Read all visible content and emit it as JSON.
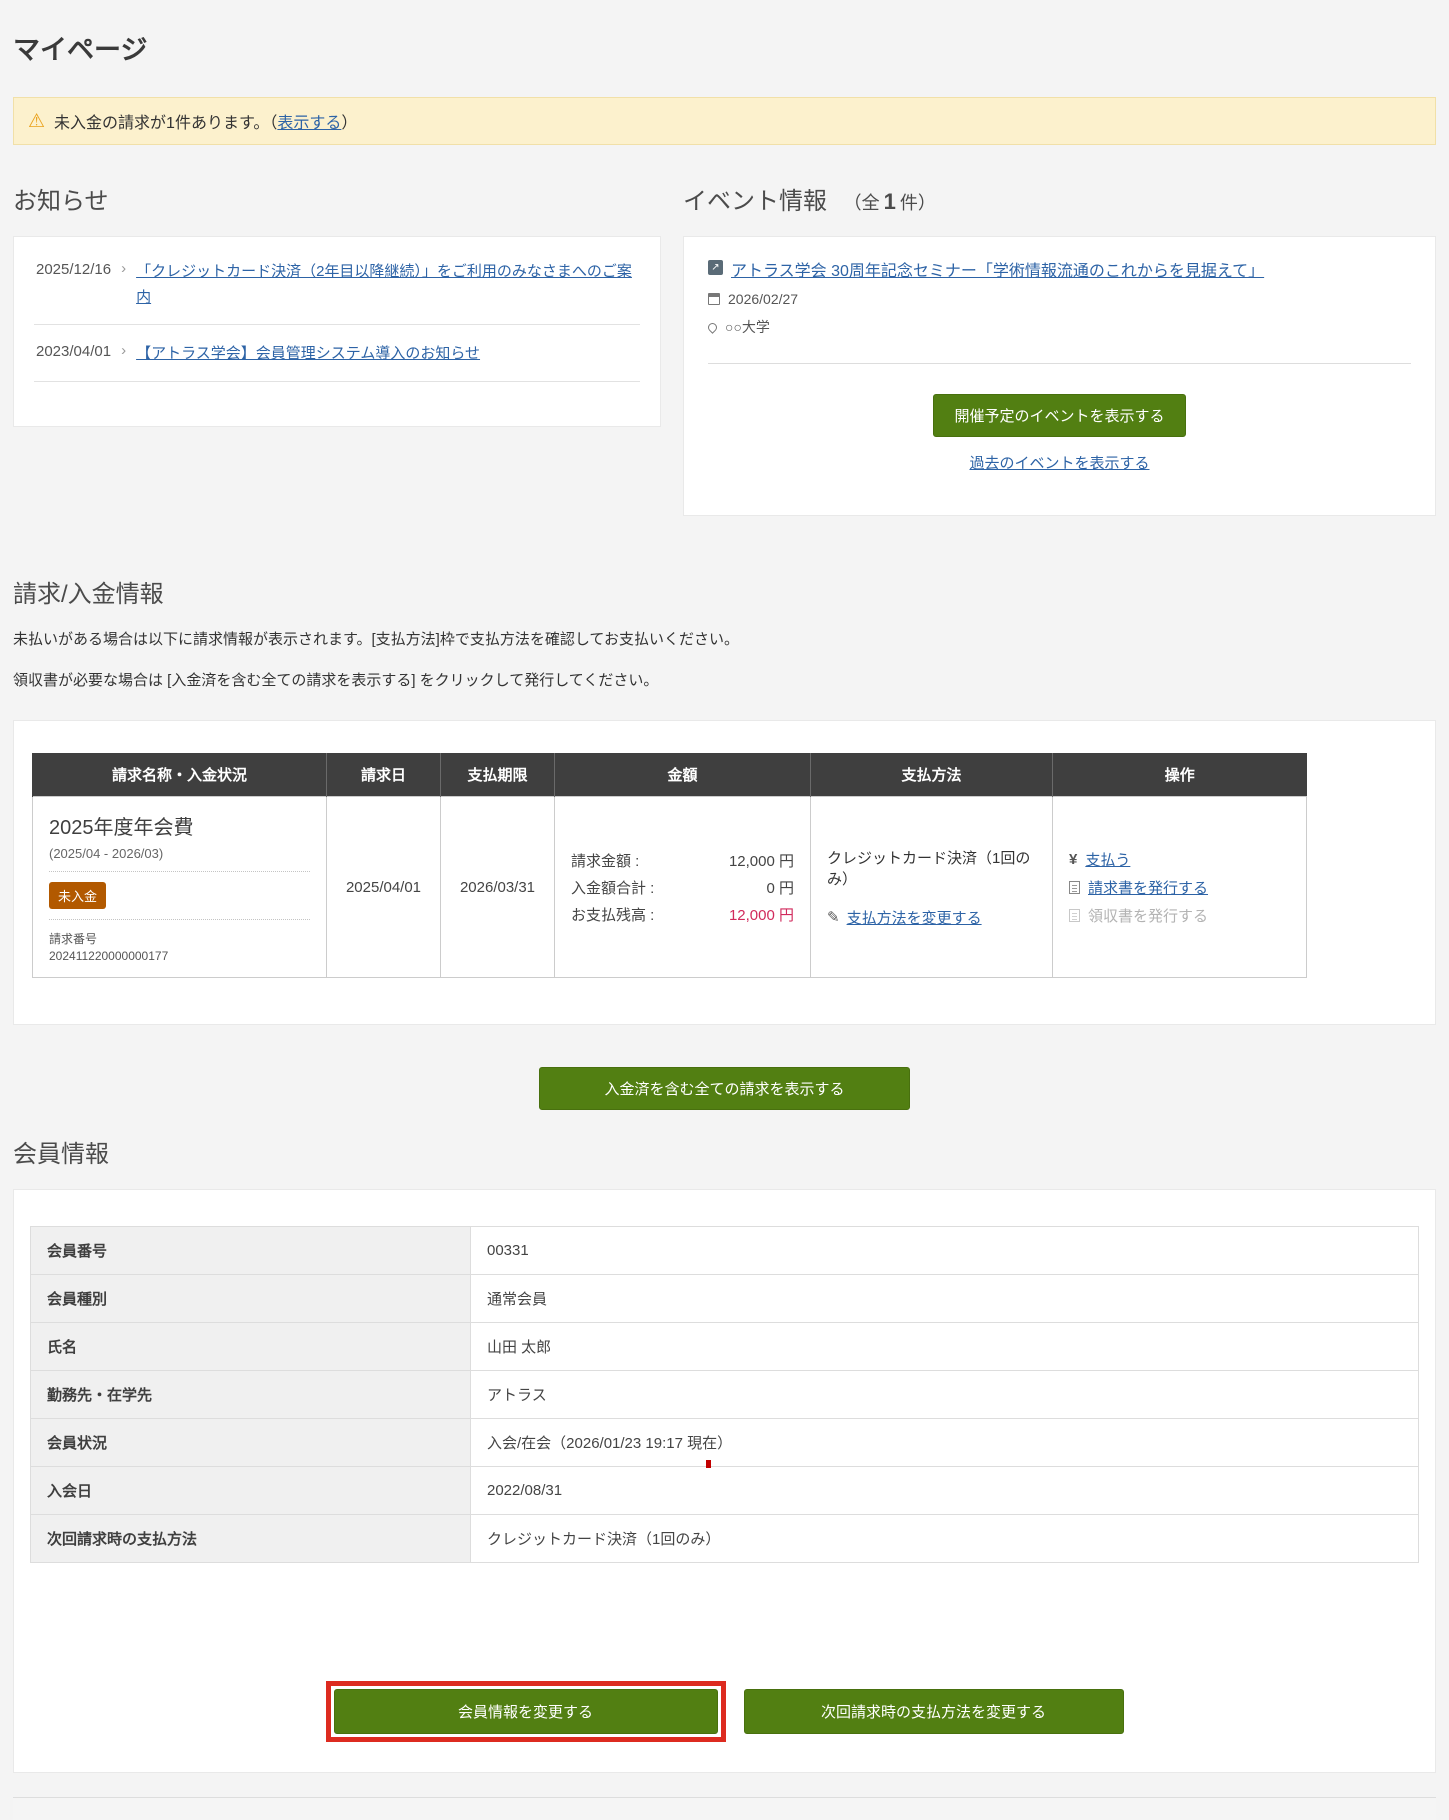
{
  "page": {
    "title": "マイページ"
  },
  "warning": {
    "text_before": "未入金の請求が1件あります。（",
    "link_label": "表示する",
    "text_after": "）"
  },
  "notices": {
    "heading": "お知らせ",
    "items": [
      {
        "date": "2025/12/16",
        "title": "「クレジットカード決済（2年目以降継続）」をご利用のみなさまへのご案内"
      },
      {
        "date": "2023/04/01",
        "title": "【アトラス学会】会員管理システム導入のお知らせ"
      }
    ]
  },
  "events": {
    "heading": "イベント情報",
    "count_prefix": "（全",
    "count": "1",
    "count_suffix": "件）",
    "item": {
      "title": "アトラス学会 30周年記念セミナー「学術情報流通のこれからを見据えて」",
      "date": "2026/02/27",
      "place": "○○大学"
    },
    "upcoming_button": "開催予定のイベントを表示する",
    "past_link": "過去のイベントを表示する"
  },
  "billing": {
    "heading": "請求/入金情報",
    "desc1": "未払いがある場合は以下に請求情報が表示されます。[支払方法]枠で支払方法を確認してお支払いください。",
    "desc2": "領収書が必要な場合は [入金済を含む全ての請求を表示する] をクリックして発行してください。",
    "headers": [
      "請求名称・入金状況",
      "請求日",
      "支払期限",
      "金額",
      "支払方法",
      "操作"
    ],
    "row": {
      "name": "2025年度年会費",
      "period": "(2025/04 - 2026/03)",
      "status": "未入金",
      "invoice_no_label": "請求番号",
      "invoice_no": "202411220000000177",
      "bill_date": "2025/04/01",
      "due_date": "2026/03/31",
      "amounts": [
        {
          "label": "請求金額 :",
          "value": "12,000 円"
        },
        {
          "label": "入金額合計 :",
          "value": "0 円"
        },
        {
          "label": "お支払残高 :",
          "value": "12,000 円"
        }
      ],
      "payment_method": "クレジットカード決済（1回のみ）",
      "change_payment_link": "支払方法を変更する",
      "pay_link": "支払う",
      "invoice_link": "請求書を発行する",
      "receipt_link": "領収書を発行する"
    },
    "show_all_button": "入金済を含む全ての請求を表示する"
  },
  "member": {
    "heading": "会員情報",
    "rows": [
      {
        "label": "会員番号",
        "value": "00331"
      },
      {
        "label": "会員種別",
        "value": "通常会員"
      },
      {
        "label": "氏名",
        "value": "山田 太郎"
      },
      {
        "label": "勤務先・在学先",
        "value": "アトラス"
      },
      {
        "label": "会員状況",
        "value": "入会/在会（2026/01/23 19:17 現在）"
      },
      {
        "label": "入会日",
        "value": "2022/08/31"
      },
      {
        "label": "次回請求時の支払方法",
        "value": "クレジットカード決済（1回のみ）"
      }
    ],
    "edit_button": "会員情報を変更する",
    "change_next_payment_button": "次回請求時の支払方法を変更する"
  },
  "colors": {
    "accent_green": "#527f12",
    "warning_bg": "#fcf1cd",
    "badge_unpaid": "#b25900",
    "balance_red": "#d12a5c",
    "highlight_red": "#dd2b20",
    "payment_cell_blue": "#e9f4fb",
    "table_header_dark": "#3f3f3f"
  }
}
